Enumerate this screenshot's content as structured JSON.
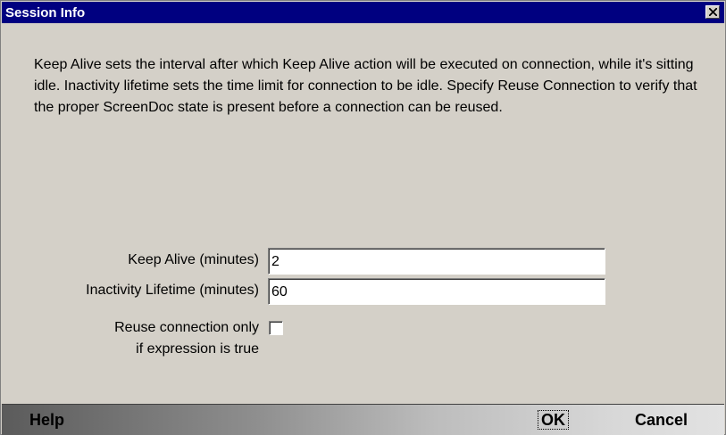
{
  "window": {
    "title": "Session Info"
  },
  "description": "Keep Alive sets the interval after which Keep Alive action will be executed on connection, while it's sitting idle. Inactivity lifetime sets the time limit for connection to be idle. Specify Reuse Connection to verify that the proper ScreenDoc state is present before a connection can be reused.",
  "form": {
    "keep_alive_label": "Keep Alive (minutes)",
    "keep_alive_value": "2",
    "inactivity_label": "Inactivity Lifetime (minutes)",
    "inactivity_value": "60",
    "reuse_label_line1": "Reuse connection only",
    "reuse_label_line2": "if expression is true",
    "reuse_checked": false
  },
  "buttons": {
    "help": "Help",
    "ok": "OK",
    "cancel": "Cancel"
  },
  "colors": {
    "titlebar": "#000080",
    "dialog_bg": "#d4d0c8"
  }
}
